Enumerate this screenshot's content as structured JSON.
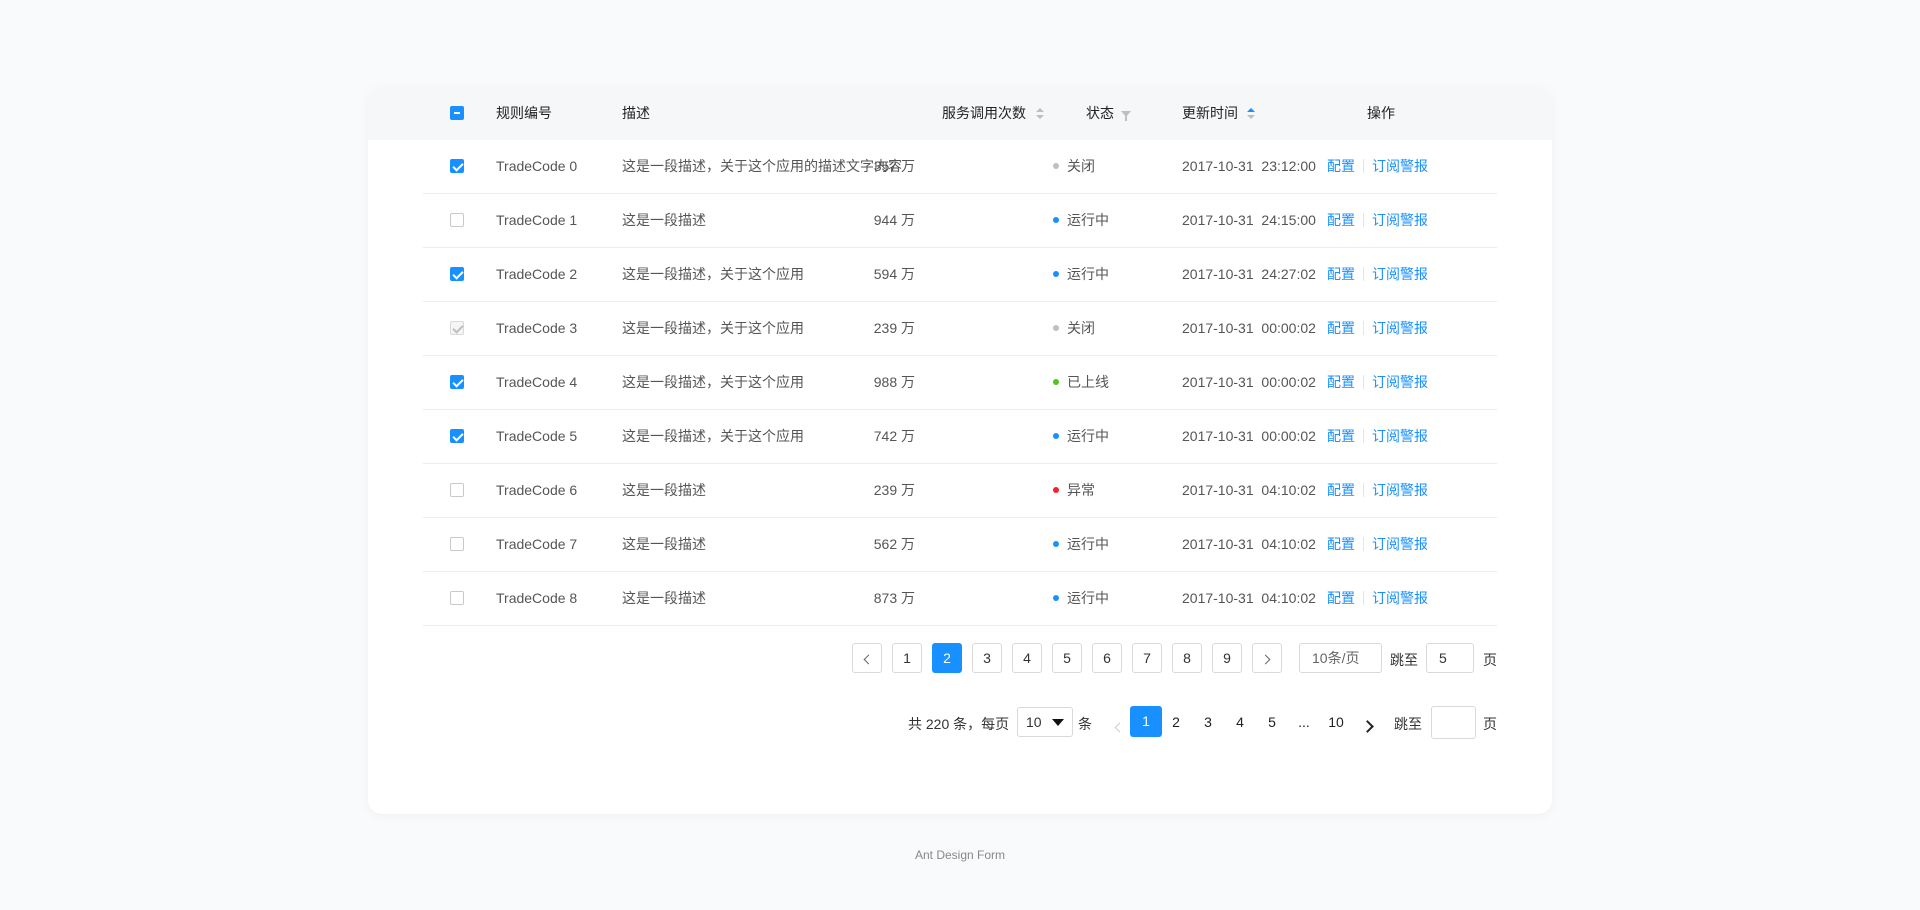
{
  "columns": {
    "code": "规则编号",
    "desc": "描述",
    "calls": "服务调用次数",
    "status": "状态",
    "updated": "更新时间",
    "actions": "操作"
  },
  "rows": [
    {
      "checked": "on",
      "code": "TradeCode 0",
      "desc": "这是一段描述，关于这个应用的描述文字内容",
      "calls": "357 万",
      "status": "关闭",
      "status_color": "#bfbfbf",
      "date": "2017-10-31",
      "time": "23:12:00"
    },
    {
      "checked": "off",
      "code": "TradeCode 1",
      "desc": "这是一段描述",
      "calls": "944 万",
      "status": "运行中",
      "status_color": "#1890ff",
      "date": "2017-10-31",
      "time": "24:15:00"
    },
    {
      "checked": "on",
      "code": "TradeCode 2",
      "desc": "这是一段描述，关于这个应用",
      "calls": "594 万",
      "status": "运行中",
      "status_color": "#1890ff",
      "date": "2017-10-31",
      "time": "24:27:02"
    },
    {
      "checked": "dis",
      "code": "TradeCode 3",
      "desc": "这是一段描述，关于这个应用",
      "calls": "239 万",
      "status": "关闭",
      "status_color": "#bfbfbf",
      "date": "2017-10-31",
      "time": "00:00:02"
    },
    {
      "checked": "on",
      "code": "TradeCode 4",
      "desc": "这是一段描述，关于这个应用",
      "calls": "988 万",
      "status": "已上线",
      "status_color": "#52c41a",
      "date": "2017-10-31",
      "time": "00:00:02"
    },
    {
      "checked": "on",
      "code": "TradeCode 5",
      "desc": "这是一段描述，关于这个应用",
      "calls": "742 万",
      "status": "运行中",
      "status_color": "#1890ff",
      "date": "2017-10-31",
      "time": "00:00:02"
    },
    {
      "checked": "off",
      "code": "TradeCode 6",
      "desc": "这是一段描述",
      "calls": "239 万",
      "status": "异常",
      "status_color": "#f5222d",
      "date": "2017-10-31",
      "time": "04:10:02"
    },
    {
      "checked": "off",
      "code": "TradeCode 7",
      "desc": "这是一段描述",
      "calls": "562 万",
      "status": "运行中",
      "status_color": "#1890ff",
      "date": "2017-10-31",
      "time": "04:10:02"
    },
    {
      "checked": "off",
      "code": "TradeCode 8",
      "desc": "这是一段描述",
      "calls": "873 万",
      "status": "运行中",
      "status_color": "#1890ff",
      "date": "2017-10-31",
      "time": "04:10:02"
    }
  ],
  "actions": {
    "config": "配置",
    "subscribe": "订阅警报"
  },
  "pagination1": {
    "pages": [
      "1",
      "2",
      "3",
      "4",
      "5",
      "6",
      "7",
      "8",
      "9"
    ],
    "active_page": "2",
    "page_size": "10条/页",
    "jump_label": "跳至",
    "jump_value": "5",
    "page_suffix": "页"
  },
  "pagination2": {
    "total_text": "共 220 条，每页",
    "size_value": "10",
    "size_suffix": "条",
    "pages": [
      "1",
      "2",
      "3",
      "4",
      "5",
      "...",
      "10"
    ],
    "active_page": "1",
    "jump_label": "跳至",
    "page_suffix": "页"
  },
  "footer": "Ant Design Form"
}
